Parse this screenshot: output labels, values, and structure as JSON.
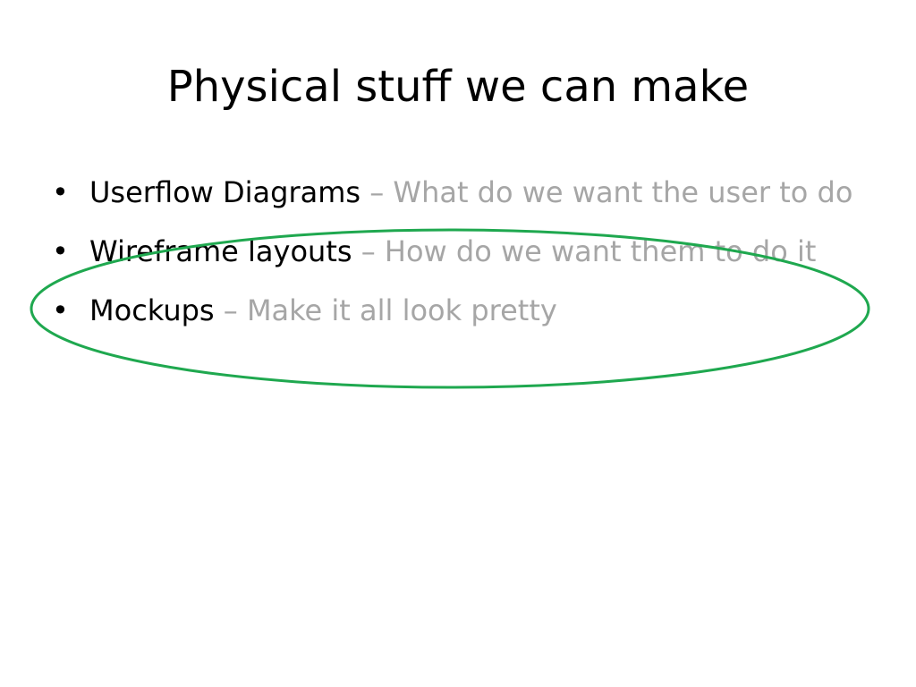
{
  "slide": {
    "title": "Physical stuff we can make",
    "bullets": [
      {
        "term": "Userflow Diagrams",
        "description": " – What do we want the user to do"
      },
      {
        "term": "Wireframe layouts",
        "description": " – How do we want them to do it"
      },
      {
        "term": "Mockups",
        "description": " – Make it all look pretty"
      }
    ],
    "bullet_glyph": "•"
  },
  "colors": {
    "term": "#000000",
    "description": "#a6a6a6",
    "highlight_ellipse": "#1fa84f"
  }
}
